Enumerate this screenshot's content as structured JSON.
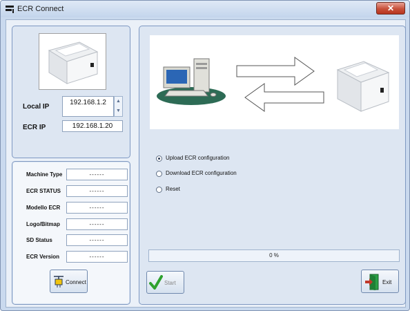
{
  "window": {
    "title": "ECR Connect",
    "close_icon": "close-icon",
    "app_icon": "app-icon"
  },
  "connection": {
    "local_ip_label": "Local IP",
    "local_ip_value": "192.168.1.2",
    "ecr_ip_label": "ECR IP",
    "ecr_ip_value": "192.168.1.20"
  },
  "status": [
    {
      "label": "Machine Type",
      "value": "------"
    },
    {
      "label": "ECR STATUS",
      "value": "------"
    },
    {
      "label": "Modello ECR",
      "value": "------"
    },
    {
      "label": "Logo/Bitmap",
      "value": "------"
    },
    {
      "label": "SD Status",
      "value": "------"
    },
    {
      "label": "ECR Version",
      "value": "------"
    }
  ],
  "options": {
    "selected": 0,
    "items": [
      "Upload ECR configuration",
      "Download ECR configuration",
      "Reset"
    ]
  },
  "progress": {
    "percent": 0,
    "text": "0 %"
  },
  "buttons": {
    "connect": "Connect",
    "start": "Start",
    "exit": "Exit"
  },
  "colors": {
    "accent": "#7f98c0",
    "start_check": "#2ea12e",
    "exit_door": "#2aa146",
    "exit_arrow": "#c0392b"
  }
}
